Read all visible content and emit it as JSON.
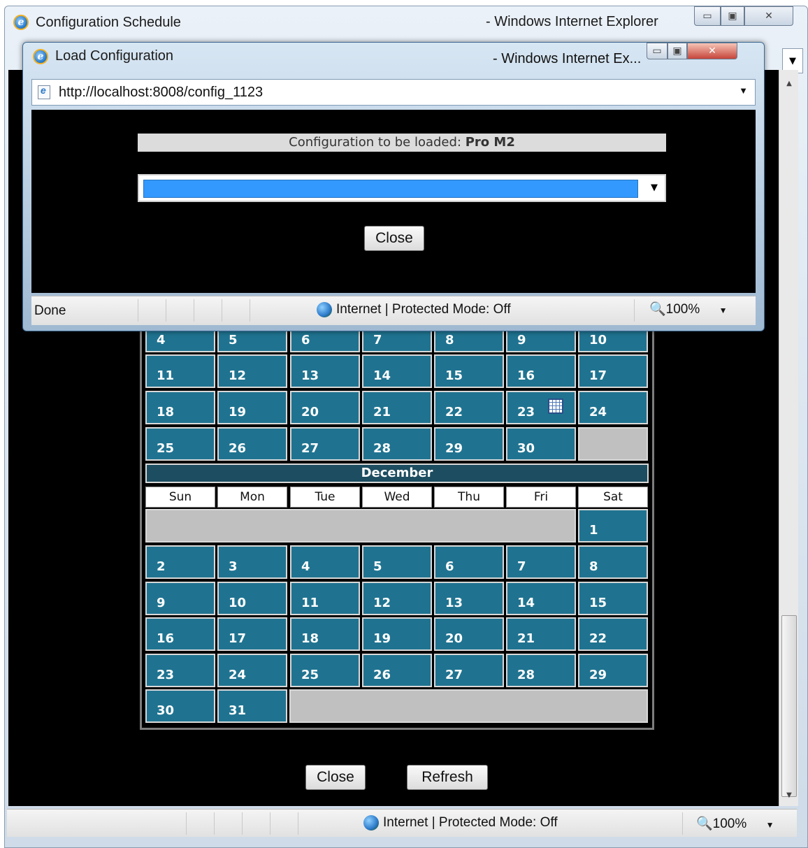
{
  "main_window": {
    "title": "Configuration Schedule",
    "title_suffix": "- Windows Internet Explorer",
    "status": {
      "zone": "Internet | Protected Mode: Off",
      "zoom": "100%"
    },
    "buttons": {
      "close": "Close",
      "refresh": "Refresh"
    }
  },
  "calendar": {
    "november_partial_rows": [
      [
        "4",
        "5",
        "6",
        "7",
        "8",
        "9",
        "10"
      ],
      [
        "11",
        "12",
        "13",
        "14",
        "15",
        "16",
        "17"
      ],
      [
        "18",
        "19",
        "20",
        "21",
        "22",
        "23",
        "24"
      ],
      [
        "25",
        "26",
        "27",
        "28",
        "29",
        "30"
      ]
    ],
    "december": {
      "name": "December",
      "weekdays": [
        "Sun",
        "Mon",
        "Tue",
        "Wed",
        "Thu",
        "Fri",
        "Sat"
      ],
      "rows": [
        [
          "1"
        ],
        [
          "2",
          "3",
          "4",
          "5",
          "6",
          "7",
          "8"
        ],
        [
          "9",
          "10",
          "11",
          "12",
          "13",
          "14",
          "15"
        ],
        [
          "16",
          "17",
          "18",
          "19",
          "20",
          "21",
          "22"
        ],
        [
          "23",
          "24",
          "25",
          "26",
          "27",
          "28",
          "29"
        ],
        [
          "30",
          "31"
        ]
      ]
    }
  },
  "popup": {
    "title": "Load Configuration",
    "title_suffix": "- Windows Internet Ex...",
    "address": "http://localhost:8008/config_1123",
    "config_label": "Configuration to be loaded:",
    "config_name": "Pro M2",
    "close_button": "Close",
    "status": {
      "text": "Done",
      "zone": "Internet | Protected Mode: Off",
      "zoom": "100%"
    }
  },
  "colors": {
    "day_cell": "#1f7390",
    "month_header": "#1c4d60",
    "select_highlight": "#3399ff",
    "empty_cell": "#c0c0c0"
  }
}
